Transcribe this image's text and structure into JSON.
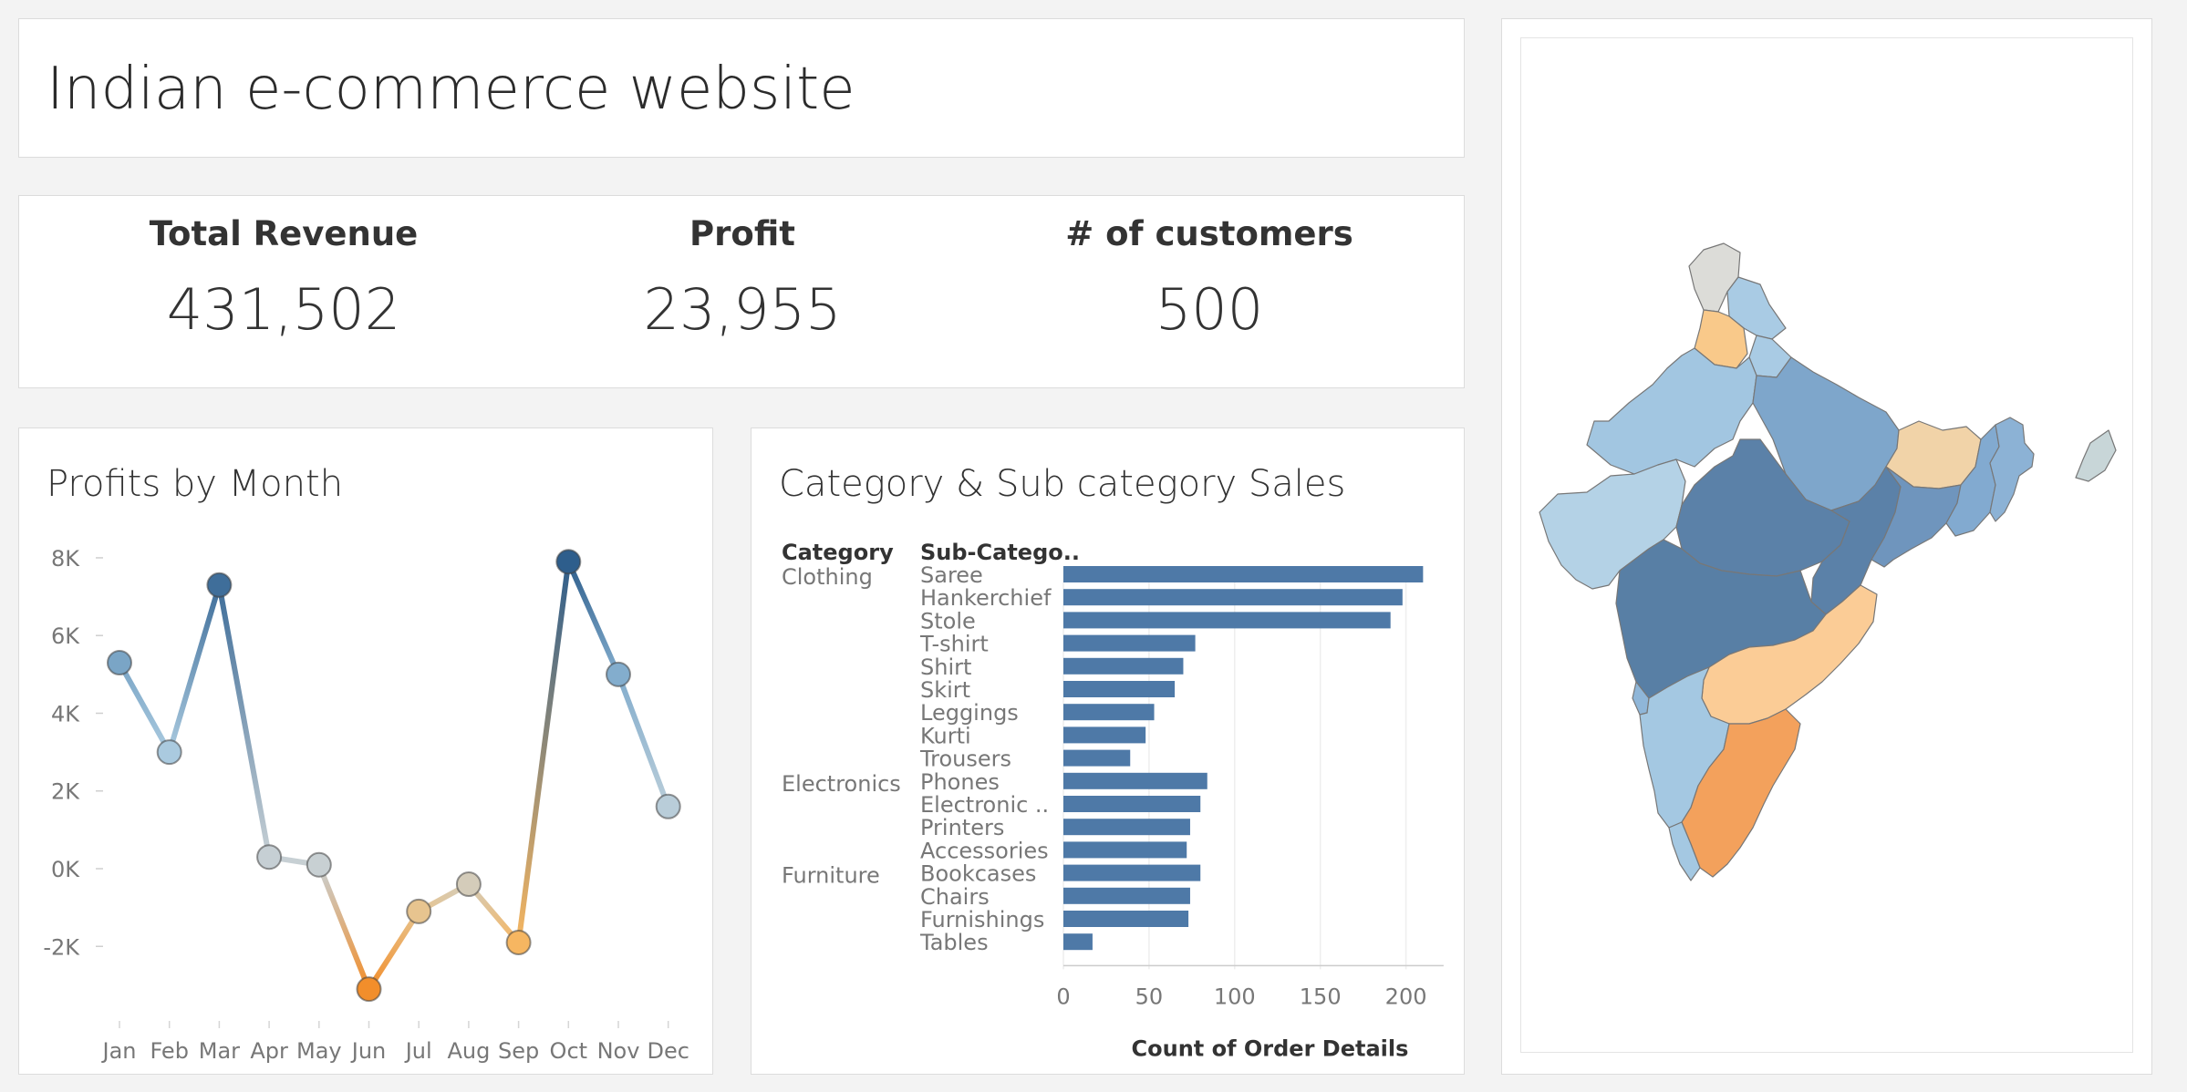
{
  "header": {
    "title": "Indian e-commerce website"
  },
  "kpis": [
    {
      "label": "Total Revenue",
      "value": "431,502"
    },
    {
      "label": "Profit",
      "value": "23,955"
    },
    {
      "label": "# of customers",
      "value": "500"
    }
  ],
  "colors": {
    "blue_dark": "#2b5b8a",
    "blue_mid": "#4e79a7",
    "blue_light": "#a0c8e3",
    "neutral": "#c9d0d3",
    "orange_light": "#f7bd6a",
    "orange_dark": "#f28e2b",
    "bar": "#4e79a7"
  },
  "chart_data": [
    {
      "type": "line",
      "title": "Profits by Month",
      "categories": [
        "Jan",
        "Feb",
        "Mar",
        "Apr",
        "May",
        "Jun",
        "Jul",
        "Aug",
        "Sep",
        "Oct",
        "Nov",
        "Dec"
      ],
      "values": [
        5300,
        3000,
        7300,
        300,
        100,
        -3100,
        -1100,
        -400,
        -1900,
        7900,
        5000,
        1600
      ],
      "ylim": [
        -4000,
        8500
      ],
      "yticks": [
        8000,
        6000,
        4000,
        2000,
        0,
        -2000
      ],
      "ytick_labels": [
        "8K",
        "6K",
        "4K",
        "2K",
        "0K",
        "-2K"
      ],
      "color_scale": "diverging orange-blue by profit"
    },
    {
      "type": "bar",
      "title": "Category & Sub category Sales",
      "column_headers": [
        "Category",
        "Sub-Catego.."
      ],
      "groups": [
        {
          "category": "Clothing",
          "subcategories": [
            "Saree",
            "Hankerchief",
            "Stole",
            "T-shirt",
            "Shirt",
            "Skirt",
            "Leggings",
            "Kurti",
            "Trousers"
          ],
          "values": [
            210,
            198,
            191,
            77,
            70,
            65,
            53,
            48,
            39
          ]
        },
        {
          "category": "Electronics",
          "subcategories": [
            "Phones",
            "Electronic ..",
            "Printers",
            "Accessories"
          ],
          "values": [
            84,
            80,
            74,
            72
          ]
        },
        {
          "category": "Furniture",
          "subcategories": [
            "Bookcases",
            "Chairs",
            "Furnishings",
            "Tables"
          ],
          "values": [
            80,
            74,
            73,
            17
          ]
        }
      ],
      "xlabel": "Count of Order Details",
      "xlim": [
        0,
        222
      ],
      "xticks": [
        0,
        50,
        100,
        150,
        200
      ]
    }
  ],
  "map": {
    "regions": [
      {
        "id": "jammu-kashmir",
        "color": "#dcdcd8"
      },
      {
        "id": "himachal",
        "color": "#a9cbe4"
      },
      {
        "id": "punjab",
        "color": "#f9c98a"
      },
      {
        "id": "uttarakhand",
        "color": "#a9cbe4"
      },
      {
        "id": "rajasthan",
        "color": "#a2c6e1"
      },
      {
        "id": "uttar-pradesh",
        "color": "#7ea6cb"
      },
      {
        "id": "bihar",
        "color": "#f1d3a8"
      },
      {
        "id": "gujarat",
        "color": "#b4d2e6"
      },
      {
        "id": "madhya-pradesh",
        "color": "#5b81a8"
      },
      {
        "id": "chhattisgarh",
        "color": "#5b81a8"
      },
      {
        "id": "jharkhand-odisha",
        "color": "#6f95bd"
      },
      {
        "id": "maharashtra",
        "color": "#587fa5"
      },
      {
        "id": "west-bengal",
        "color": "#82aad0"
      },
      {
        "id": "northeast",
        "color": "#8cb2d5"
      },
      {
        "id": "karnataka",
        "color": "#a4c8e2"
      },
      {
        "id": "goa",
        "color": "#8fb6d8"
      },
      {
        "id": "telangana-andhra",
        "color": "#fbcc96"
      },
      {
        "id": "tamil-nadu",
        "color": "#f3a15c"
      },
      {
        "id": "kerala",
        "color": "#a4c8e2"
      },
      {
        "id": "andaman",
        "color": "#c8d6d8"
      }
    ]
  }
}
